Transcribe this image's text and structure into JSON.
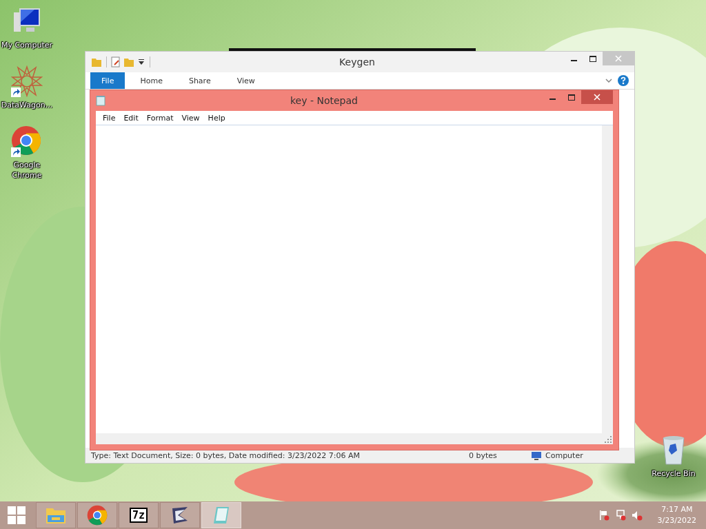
{
  "desktop": {
    "icons": [
      {
        "label": "My Computer",
        "kind": "computer",
        "shortcut": false
      },
      {
        "label": "DataWagon...",
        "kind": "star",
        "shortcut": true
      },
      {
        "label": "Google Chrome",
        "kind": "chrome",
        "shortcut": true
      },
      {
        "label": "Recycle Bin",
        "kind": "bin",
        "shortcut": false
      }
    ]
  },
  "explorer": {
    "title": "Keygen",
    "ribbon_tabs": [
      {
        "label": "File",
        "selected": true
      },
      {
        "label": "Home",
        "selected": false
      },
      {
        "label": "Share",
        "selected": false
      },
      {
        "label": "View",
        "selected": false
      }
    ],
    "status_bar": {
      "details": "Type: Text Document, Size: 0 bytes, Date modified: 3/23/2022 7:06 AM",
      "size": "0 bytes",
      "location": "Computer"
    }
  },
  "notepad": {
    "title": "key - Notepad",
    "menu": [
      "File",
      "Edit",
      "Format",
      "View",
      "Help"
    ]
  },
  "taskbar": {
    "apps": [
      {
        "kind": "explorer",
        "active": false
      },
      {
        "kind": "chrome",
        "active": false
      },
      {
        "kind": "archive",
        "label": "7z",
        "active": false
      },
      {
        "kind": "tool",
        "active": false
      },
      {
        "kind": "notepad",
        "active": true
      }
    ],
    "tray": {
      "time": "7:17 AM",
      "date": "3/23/2022"
    }
  }
}
